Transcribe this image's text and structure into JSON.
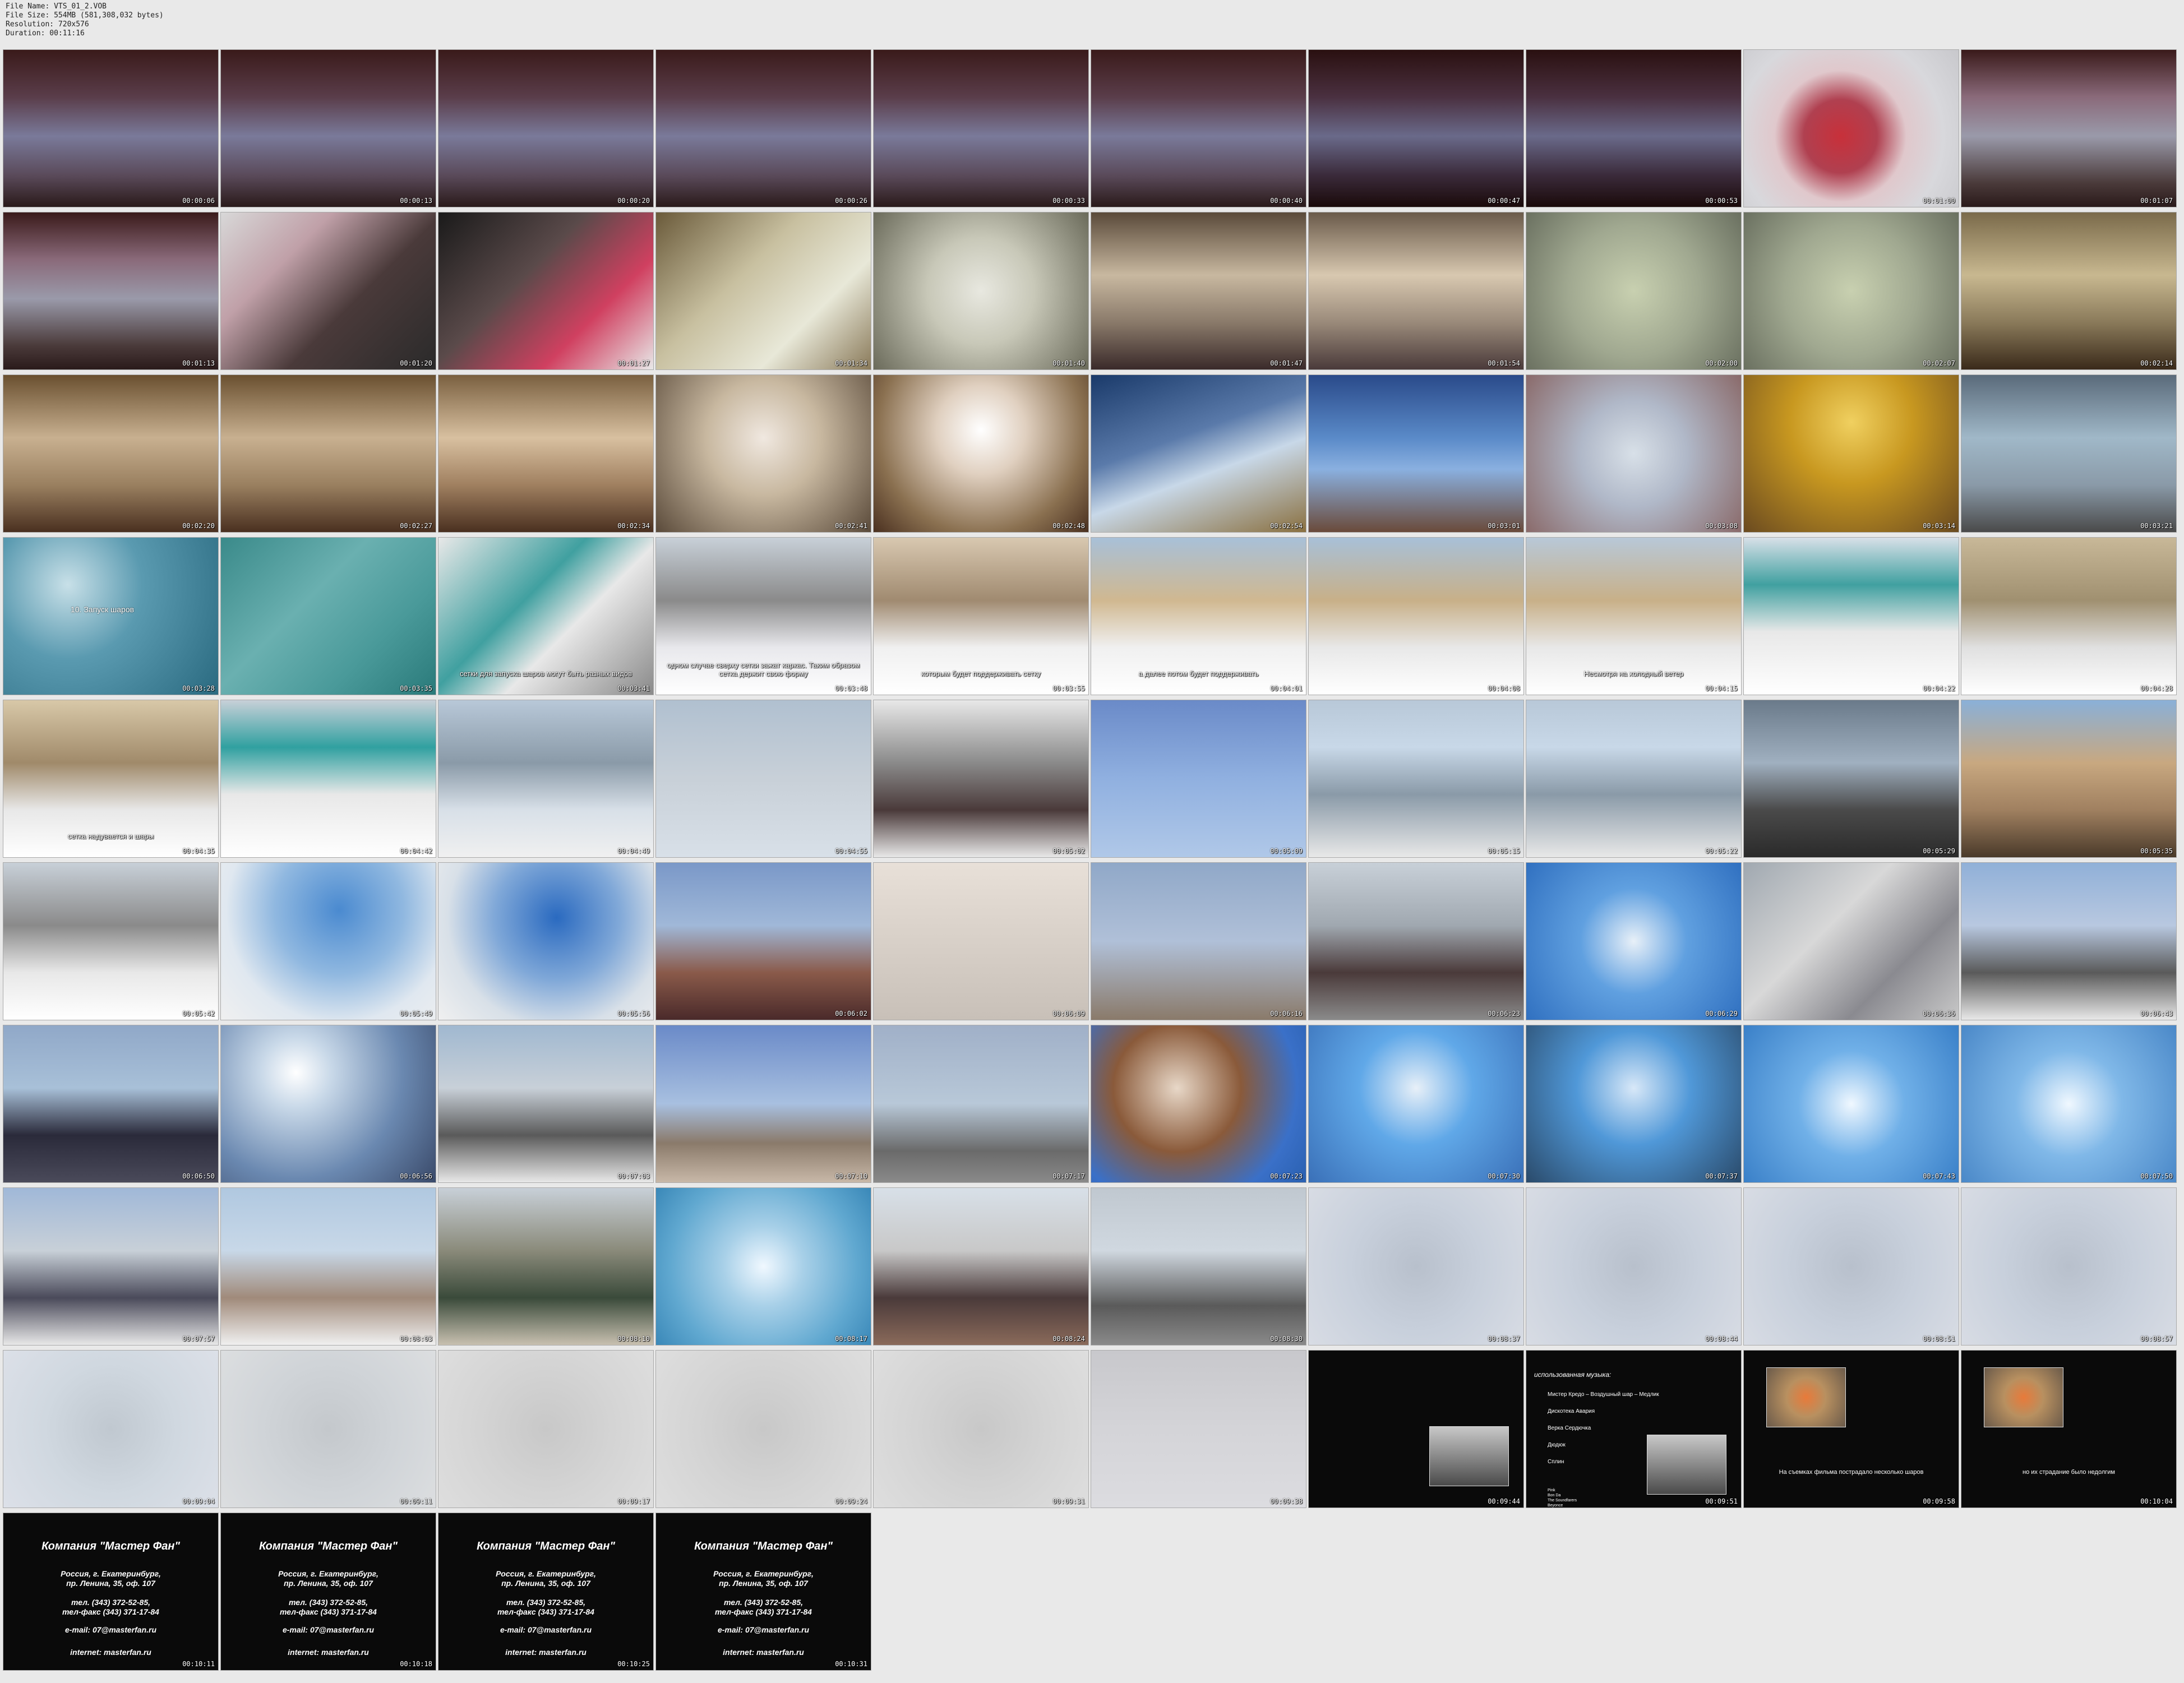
{
  "file_info": [
    "File Name: VTS_01_2.VOB",
    "File Size: 554MB (581,308,032 bytes)",
    "Resolution: 720x576",
    "Duration: 00:11:16"
  ],
  "frames": [
    {
      "time": "00:00:06",
      "bg": "linear-gradient(180deg,#3a1a1a 0%,#5a3d4a 30%,#7a7a9a 55%,#5a4a5a 80%,#2a1a1a 100%)"
    },
    {
      "time": "00:00:13",
      "bg": "linear-gradient(180deg,#3a1a1a 0%,#5a3d4a 30%,#7a7a9a 55%,#5a4a5a 80%,#2a1a1a 100%)"
    },
    {
      "time": "00:00:20",
      "bg": "linear-gradient(180deg,#3a1a1a 0%,#5a3d4a 30%,#7a7a9a 55%,#5a4a5a 80%,#2a1a1a 100%)"
    },
    {
      "time": "00:00:26",
      "bg": "linear-gradient(180deg,#3a1a1a 0%,#5a3d4a 30%,#7a7a9a 55%,#5a4a5a 80%,#2a1a1a 100%)"
    },
    {
      "time": "00:00:33",
      "bg": "linear-gradient(180deg,#3a1a1a 0%,#5a3d4a 30%,#7a7a9a 55%,#5a4a5a 80%,#2a1a1a 100%)"
    },
    {
      "time": "00:00:40",
      "bg": "linear-gradient(180deg,#3a1a1a 0%,#5a3d4a 30%,#7a7a9a 55%,#5a4a5a 80%,#2a1a1a 100%)"
    },
    {
      "time": "00:00:47",
      "bg": "linear-gradient(180deg,#2a1010 0%,#4a3040 30%,#6a6a8a 55%,#3a2a3a 80%,#1a0a0a 100%)"
    },
    {
      "time": "00:00:53",
      "bg": "linear-gradient(180deg,#2a1010 0%,#4a3040 30%,#6a6a8a 55%,#3a2a3a 80%,#1a0a0a 100%)"
    },
    {
      "time": "00:01:00",
      "bg": "radial-gradient(circle at 45% 55%,#c8303a 0%,#b04050 25%,#e0c8cc 45%,#d8d8dc 70%,#c8c8cc 100%)"
    },
    {
      "time": "00:01:07",
      "bg": "linear-gradient(180deg,#3a1a1a 0%,#8a6a7a 30%,#9a9aaa 55%,#4a3a3a 85%,#2a1a1a 100%)"
    },
    {
      "time": "00:01:13",
      "bg": "linear-gradient(180deg,#3a1a1a 0%,#8a6a7a 30%,#9a9aaa 55%,#4a3a3a 85%,#2a1a1a 100%)"
    },
    {
      "time": "00:01:20",
      "bg": "linear-gradient(135deg,#d8d8d8 0%,#c0a0a8 30%,#4a3a3a 60%,#2a2a2a 100%)"
    },
    {
      "time": "00:01:27",
      "bg": "linear-gradient(135deg,#1a1a1a 0%,#5a4a4a 40%,#d04060 70%,#e8e8e8 100%)"
    },
    {
      "time": "00:01:34",
      "bg": "linear-gradient(135deg,#6a5a3a 0%,#c8c0a0 40%,#e8e8d8 70%,#8a7a5a 100%)"
    },
    {
      "time": "00:01:40",
      "bg": "radial-gradient(circle at 50% 50%,#e8e8e0 0%,#c8c8b8 40%,#6a6a5a 100%)"
    },
    {
      "time": "00:01:47",
      "bg": "linear-gradient(180deg,#5a4a3a 0%,#c8b8a0 40%,#8a7a6a 70%,#3a2a2a 100%)"
    },
    {
      "time": "00:01:54",
      "bg": "linear-gradient(180deg,#6a5a4a 0%,#d8c8b0 40%,#9a8a7a 70%,#4a3a3a 100%)"
    },
    {
      "time": "00:02:00",
      "bg": "radial-gradient(circle at 50% 50%,#c8d0b0 0%,#a0a890 50%,#6a7060 100%)"
    },
    {
      "time": "00:02:07",
      "bg": "radial-gradient(circle at 50% 50%,#c8d0b0 0%,#a0a890 50%,#6a7060 100%)"
    },
    {
      "time": "00:02:14",
      "bg": "linear-gradient(180deg,#7a6a4a 0%,#c8b890 40%,#8a7a5a 70%,#3a2a1a 100%)"
    },
    {
      "time": "00:02:20",
      "bg": "linear-gradient(180deg,#6a5030 0%,#c8b090 40%,#9a8060 70%,#4a3020 100%)"
    },
    {
      "time": "00:02:27",
      "bg": "linear-gradient(180deg,#6a5030 0%,#c8b090 40%,#9a8060 70%,#4a3020 100%)"
    },
    {
      "time": "00:02:34",
      "bg": "linear-gradient(180deg,#7a6040 0%,#d8c0a0 40%,#a08060 70%,#4a3020 100%)"
    },
    {
      "time": "00:02:41",
      "bg": "radial-gradient(circle at 50% 40%,#f0e8e0 0%,#c8b8a0 40%,#5a4a3a 100%)"
    },
    {
      "time": "00:02:48",
      "bg": "radial-gradient(circle at 50% 35%,#ffffff 0%,#e0d0c0 30%,#8a7050 70%,#4a3020 100%)"
    },
    {
      "time": "00:02:54",
      "bg": "linear-gradient(160deg,#1a3a6a 0%,#5a7aaa 40%,#c8d8e8 60%,#8a7040 100%)"
    },
    {
      "time": "00:03:01",
      "bg": "linear-gradient(180deg,#2a4a8a 0%,#5a8ac8 40%,#8ab0e0 60%,#6a4a3a 100%)"
    },
    {
      "time": "00:03:08",
      "bg": "radial-gradient(circle at 50% 50%,#d8e0e8 0%,#b0b8c8 40%,#8a6a6a 100%)"
    },
    {
      "time": "00:03:14",
      "bg": "radial-gradient(circle at 50% 30%,#f0d060 0%,#c89820 40%,#6a4a20 100%)"
    },
    {
      "time": "00:03:21",
      "bg": "linear-gradient(180deg,#5a6a7a 0%,#a0b8c8 40%,#8a9aa8 70%,#4a4a4a 100%)"
    },
    {
      "time": "00:03:28",
      "bg": "radial-gradient(circle at 30% 30%,#c8e0e8 0%,#5a9ab0 40%,#2a6a80 100%)",
      "title": "10. Запуск шаров"
    },
    {
      "time": "00:03:35",
      "bg": "linear-gradient(135deg,#3a8a8a 0%,#6ab0b0 40%,#4a9a9a 70%,#2a7a7a 100%)"
    },
    {
      "time": "00:03:41",
      "bg": "linear-gradient(135deg,#e8e8e8 0%,#40a0a0 40%,#e8e8e8 60%,#8a8a8a 100%)",
      "sub": "сетки для запуска шаров могут быть разных видов"
    },
    {
      "time": "00:03:48",
      "bg": "linear-gradient(180deg,#c8d0d8 0%,#8a8a8a 40%,#e8e8ec 70%,#ffffff 100%)",
      "sub": "одном случае сверху сетки зажат каркас. Таким образом сетка держит свою форму"
    },
    {
      "time": "00:03:55",
      "bg": "linear-gradient(180deg,#d8c8b0 0%,#a08a70 40%,#f0f0f0 70%,#ffffff 100%)",
      "sub": "которым будет поддерживать сетку"
    },
    {
      "time": "00:04:01",
      "bg": "linear-gradient(180deg,#a8c0d8 0%,#d0b890 40%,#f0f0f0 70%,#ffffff 100%)",
      "sub": "а далее потом будет поддерживать"
    },
    {
      "time": "00:04:08",
      "bg": "linear-gradient(180deg,#a8c0d8 0%,#c8b088 40%,#e8e8e8 70%,#ffffff 100%)"
    },
    {
      "time": "00:04:15",
      "bg": "linear-gradient(180deg,#b8c8d8 0%,#c8b088 40%,#e8e8e8 70%,#ffffff 100%)",
      "sub": "Несмотря на холодный ветер"
    },
    {
      "time": "00:04:22",
      "bg": "linear-gradient(180deg,#d8e0e8 0%,#40a0a0 30%,#e8e8e8 60%,#ffffff 100%)"
    },
    {
      "time": "00:04:28",
      "bg": "linear-gradient(180deg,#c8b898 0%,#a09070 40%,#e0e0e0 70%,#ffffff 100%)"
    },
    {
      "time": "00:04:35",
      "bg": "linear-gradient(180deg,#d8c8a8 0%,#a08a6a 40%,#e8e8e8 70%,#ffffff 100%)",
      "sub": "сетка надувается и шары"
    },
    {
      "time": "00:04:42",
      "bg": "linear-gradient(180deg,#c8d0d8 0%,#30a0a0 30%,#e8e8e8 60%,#ffffff 100%)"
    },
    {
      "time": "00:04:49",
      "bg": "linear-gradient(180deg,#b8c8d8 0%,#8a9aa8 40%,#d8e0e8 70%,#f0f0f0 100%)"
    },
    {
      "time": "00:04:55",
      "bg": "linear-gradient(180deg,#b0c0d0 0%,#c8d0d8 50%,#d8e0e8 100%)"
    },
    {
      "time": "00:05:02",
      "bg": "linear-gradient(180deg,#e8e8e8 0%,#8a8a8a 40%,#4a3a3a 70%,#e8e8e8 100%)"
    },
    {
      "time": "00:05:09",
      "bg": "linear-gradient(180deg,#6a8ac8 0%,#90b0e0 50%,#b0c8e8 100%)"
    },
    {
      "time": "00:05:15",
      "bg": "linear-gradient(180deg,#b8c8d8 0%,#c8d8e8 30%,#8a9aa8 60%,#e8e8e8 100%)"
    },
    {
      "time": "00:05:22",
      "bg": "linear-gradient(180deg,#b8c8d8 0%,#c8d8e8 30%,#8a9aa8 60%,#e8e8e8 100%)"
    },
    {
      "time": "00:05:29",
      "bg": "linear-gradient(180deg,#6a7a8a 0%,#a0b0c0 40%,#4a4a4a 70%,#2a2a2a 100%)"
    },
    {
      "time": "00:05:35",
      "bg": "linear-gradient(180deg,#8ab0d8 0%,#c8a880 40%,#a08060 70%,#4a3a2a 100%)"
    },
    {
      "time": "00:05:42",
      "bg": "linear-gradient(180deg,#c8d0d8 0%,#8a8a8a 40%,#e8e8e8 70%,#ffffff 100%)"
    },
    {
      "time": "00:05:49",
      "bg": "radial-gradient(circle at 55% 30%,#4a8ad0 0%,#90b8e0 40%,#e0e8f0 70%,#f0f0f0 100%)"
    },
    {
      "time": "00:05:56",
      "bg": "radial-gradient(circle at 55% 35%,#2a6ac0 0%,#80a8d8 40%,#d8e0e8 70%,#f0f0f0 100%)"
    },
    {
      "time": "00:06:02",
      "bg": "linear-gradient(180deg,#7a98c8 0%,#a0b8d8 40%,#8a5a4a 70%,#4a2a2a 100%)"
    },
    {
      "time": "00:06:09",
      "bg": "linear-gradient(180deg,#e8e0d8 0%,#d8d0c8 50%,#c8c0b8 100%)"
    },
    {
      "time": "00:06:16",
      "bg": "linear-gradient(180deg,#90a8c8 0%,#b0c0d8 50%,#8a7a6a 100%)"
    },
    {
      "time": "00:06:23",
      "bg": "linear-gradient(180deg,#c8d0d8 0%,#a0a8b0 40%,#4a3a3a 70%,#8a8a8a 100%)"
    },
    {
      "time": "00:06:29",
      "bg": "radial-gradient(circle at 50% 50%,#e8f0f8 0%,#60a0e0 40%,#3070c0 100%)"
    },
    {
      "time": "00:06:36",
      "bg": "linear-gradient(135deg,#a0a8b0 0%,#d8d8d8 40%,#8a8a90 70%,#c8c8c8 100%)"
    },
    {
      "time": "00:06:43",
      "bg": "linear-gradient(180deg,#90b0d8 0%,#b8c8e0 40%,#5a5a5a 70%,#e8e8e8 100%)"
    },
    {
      "time": "00:06:50",
      "bg": "linear-gradient(180deg,#90a8c8 0%,#a8c0d8 40%,#2a2a3a 70%,#4a4a5a 100%)"
    },
    {
      "time": "00:06:56",
      "bg": "radial-gradient(circle at 35% 30%,#ffffff 0%,#c8d8e8 20%,#6a88b0 60%,#3a4a6a 100%)"
    },
    {
      "time": "00:07:03",
      "bg": "linear-gradient(180deg,#a0b8d0 0%,#c8d0d8 40%,#5a5a5a 70%,#e8e8e8 100%)"
    },
    {
      "time": "00:07:10",
      "bg": "linear-gradient(180deg,#6a8ac8 0%,#a8c0e0 50%,#8a7a6a 75%,#c8b8a8 100%)"
    },
    {
      "time": "00:07:17",
      "bg": "linear-gradient(180deg,#a0b0c8 0%,#b8c8d8 50%,#6a6a6a 80%,#8a8a8a 100%)"
    },
    {
      "time": "00:07:23",
      "bg": "radial-gradient(circle at 40% 40%,#e8d8c8 0%,#8a5a3a 40%,#3a70c8 75%,#2a60b0 100%)"
    },
    {
      "time": "00:07:30",
      "bg": "radial-gradient(circle at 50% 40%,#e8f0f8 0%,#60a8e8 40%,#3a70b8 100%)"
    },
    {
      "time": "00:07:37",
      "bg": "radial-gradient(circle at 50% 40%,#d8e8f8 0%,#5098d8 40%,#2a4a6a 100%)"
    },
    {
      "time": "00:07:43",
      "bg": "radial-gradient(circle at 50% 50%,#f0f8ff 0%,#70b0e8 40%,#3a80c8 100%)"
    },
    {
      "time": "00:07:50",
      "bg": "radial-gradient(circle at 50% 50%,#f0f8ff 0%,#80b8e8 40%,#4a88c8 100%)"
    },
    {
      "time": "00:07:57",
      "bg": "linear-gradient(180deg,#a0b8d8 0%,#c8d0d8 40%,#4a4a5a 70%,#e8e8e8 100%)"
    },
    {
      "time": "00:08:03",
      "bg": "linear-gradient(180deg,#b0c8e0 0%,#c8d8e8 40%,#a08a7a 70%,#f0f0f0 100%)"
    },
    {
      "time": "00:08:10",
      "bg": "linear-gradient(180deg,#c8d0d8 0%,#8a8a7a 40%,#3a4a3a 70%,#c8c0b0 100%)"
    },
    {
      "time": "00:08:17",
      "bg": "radial-gradient(circle at 50% 50%,#f0f8ff 0%,#a8d0e8 30%,#60a8d0 70%,#3a88b8 100%)"
    },
    {
      "time": "00:08:24",
      "bg": "linear-gradient(180deg,#d8e0e8 0%,#c8c8c8 40%,#4a3a3a 70%,#8a6a5a 100%)"
    },
    {
      "time": "00:08:30",
      "bg": "linear-gradient(180deg,#c0c8d0 0%,#d0d8e0 40%,#5a5a5a 75%,#8a8a8a 100%)"
    },
    {
      "time": "00:08:37",
      "bg": "radial-gradient(circle at 50% 50%,#b8c0cc 0%,#c8d0dc 50%,#d8dce4 100%)"
    },
    {
      "time": "00:08:44",
      "bg": "radial-gradient(circle at 50% 50%,#b8c0cc 0%,#c8d0dc 50%,#d8dce4 100%)"
    },
    {
      "time": "00:08:51",
      "bg": "radial-gradient(circle at 50% 50%,#b8c0cc 0%,#c8d0dc 50%,#d8dce4 100%)"
    },
    {
      "time": "00:08:57",
      "bg": "radial-gradient(circle at 50% 50%,#b8c0cc 0%,#c8d0dc 50%,#d8dce4 100%)"
    },
    {
      "time": "00:09:04",
      "bg": "radial-gradient(circle at 50% 50%,#c0c8d0 0%,#d0d8e0 50%,#dce0e8 100%)"
    },
    {
      "time": "00:09:11",
      "bg": "radial-gradient(circle at 50% 50%,#c4c8cc 0%,#d0d4d8 50%,#dcdee0 100%)"
    },
    {
      "time": "00:09:17",
      "bg": "radial-gradient(circle at 50% 50%,#c8c8c8 0%,#d4d4d4 50%,#dedede 100%)"
    },
    {
      "time": "00:09:24",
      "bg": "radial-gradient(circle at 50% 50%,#c8c8c8 0%,#d4d4d4 50%,#dedede 100%)"
    },
    {
      "time": "00:09:31",
      "bg": "radial-gradient(circle at 50% 50%,#c8c8c8 0%,#d4d4d4 50%,#dedede 100%)"
    },
    {
      "time": "00:09:38",
      "bg": "linear-gradient(180deg,#c8c8cc 0%,#d4d4d8 50%,#dcdce0 100%)"
    },
    {
      "time": "00:09:44",
      "bg": "#0a0a0a",
      "inset": "linear-gradient(180deg,#c8c8c8 0%,#8a8a8a 50%,#4a4a4a 100%)"
    },
    {
      "time": "00:09:51",
      "bg": "#0a0a0a",
      "credits": true
    },
    {
      "time": "00:09:58",
      "bg": "#0a0a0a",
      "note": "На съемках фильма пострадало несколько шаров",
      "inset": "radial-gradient(circle at 50% 50%,#e87a3a 0%,#b89060 40%,#6a5a4a 100%)"
    },
    {
      "time": "00:10:04",
      "bg": "#0a0a0a",
      "note": "но их страдание было недолгим",
      "inset": "radial-gradient(circle at 50% 50%,#e87a3a 0%,#b89060 40%,#6a5a4a 100%)"
    },
    {
      "time": "00:10:11",
      "bg": "#0a0a0a",
      "company": true
    },
    {
      "time": "00:10:18",
      "bg": "#0a0a0a",
      "company": true
    },
    {
      "time": "00:10:25",
      "bg": "#0a0a0a",
      "company": true
    },
    {
      "time": "00:10:31",
      "bg": "#0a0a0a",
      "company": true
    }
  ],
  "credits": {
    "title": "использованная музыка:",
    "items": [
      "Мистер Кредо – Воздушный шар – Медлик",
      "Дискотека Авария",
      "Верка Сердючка",
      "Дюдюк",
      "Сплин"
    ],
    "mini": [
      "Pink",
      "Bon Da",
      "The Soundfarers",
      "Beyonce",
      "Invader",
      "Furious Man",
      "& Chiild"
    ]
  },
  "company": {
    "title": "Компания \"Мастер Фан\"",
    "address": [
      "Россия, г. Екатеринбург,",
      "пр. Ленина, 35, оф. 107"
    ],
    "phones": [
      "тел. (343) 372-52-85,",
      "тел-факс (343) 371-17-84"
    ],
    "email": "e-mail: 07@masterfan.ru",
    "site": "internet: masterfan.ru"
  }
}
